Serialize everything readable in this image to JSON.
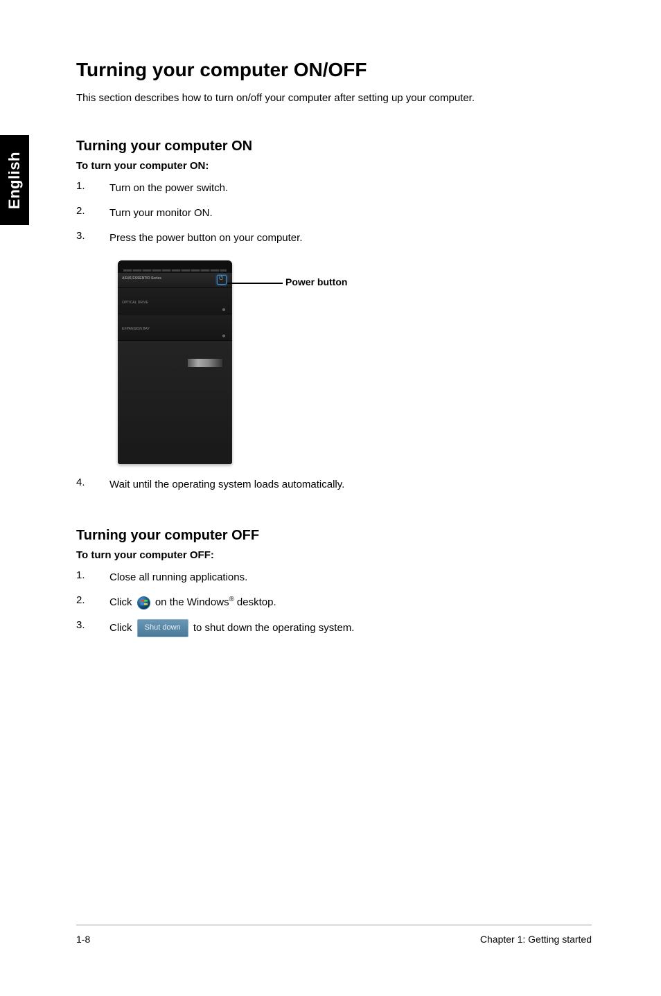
{
  "sideTab": "English",
  "title": "Turning your computer ON/OFF",
  "intro": "This section describes how to turn on/off your computer after setting up your computer.",
  "onSection": {
    "heading": "Turning your computer ON",
    "sub": "To turn your computer ON:",
    "steps": {
      "s1": "Turn on the power switch.",
      "s2": "Turn your monitor ON.",
      "s3": "Press the power button on your computer.",
      "s4": "Wait until the operating system loads automatically."
    }
  },
  "diagram": {
    "powerLabel": "Power button",
    "brand": "ASUS ESSENTIO Series",
    "drive1": "OPTICAL DRIVE",
    "drive2": "EXPANSION BAY"
  },
  "offSection": {
    "heading": "Turning your computer OFF",
    "sub": "To turn your computer OFF:",
    "steps": {
      "s1": "Close all running applications.",
      "s2_a": "Click",
      "s2_b_pre": " on the Windows",
      "s2_b_sup": "®",
      "s2_b_post": " desktop.",
      "s3_a": "Click ",
      "s3_btn": "Shut down",
      "s3_b": " to shut down the operating system."
    }
  },
  "footer": {
    "left": "1-8",
    "right": "Chapter 1: Getting started"
  }
}
